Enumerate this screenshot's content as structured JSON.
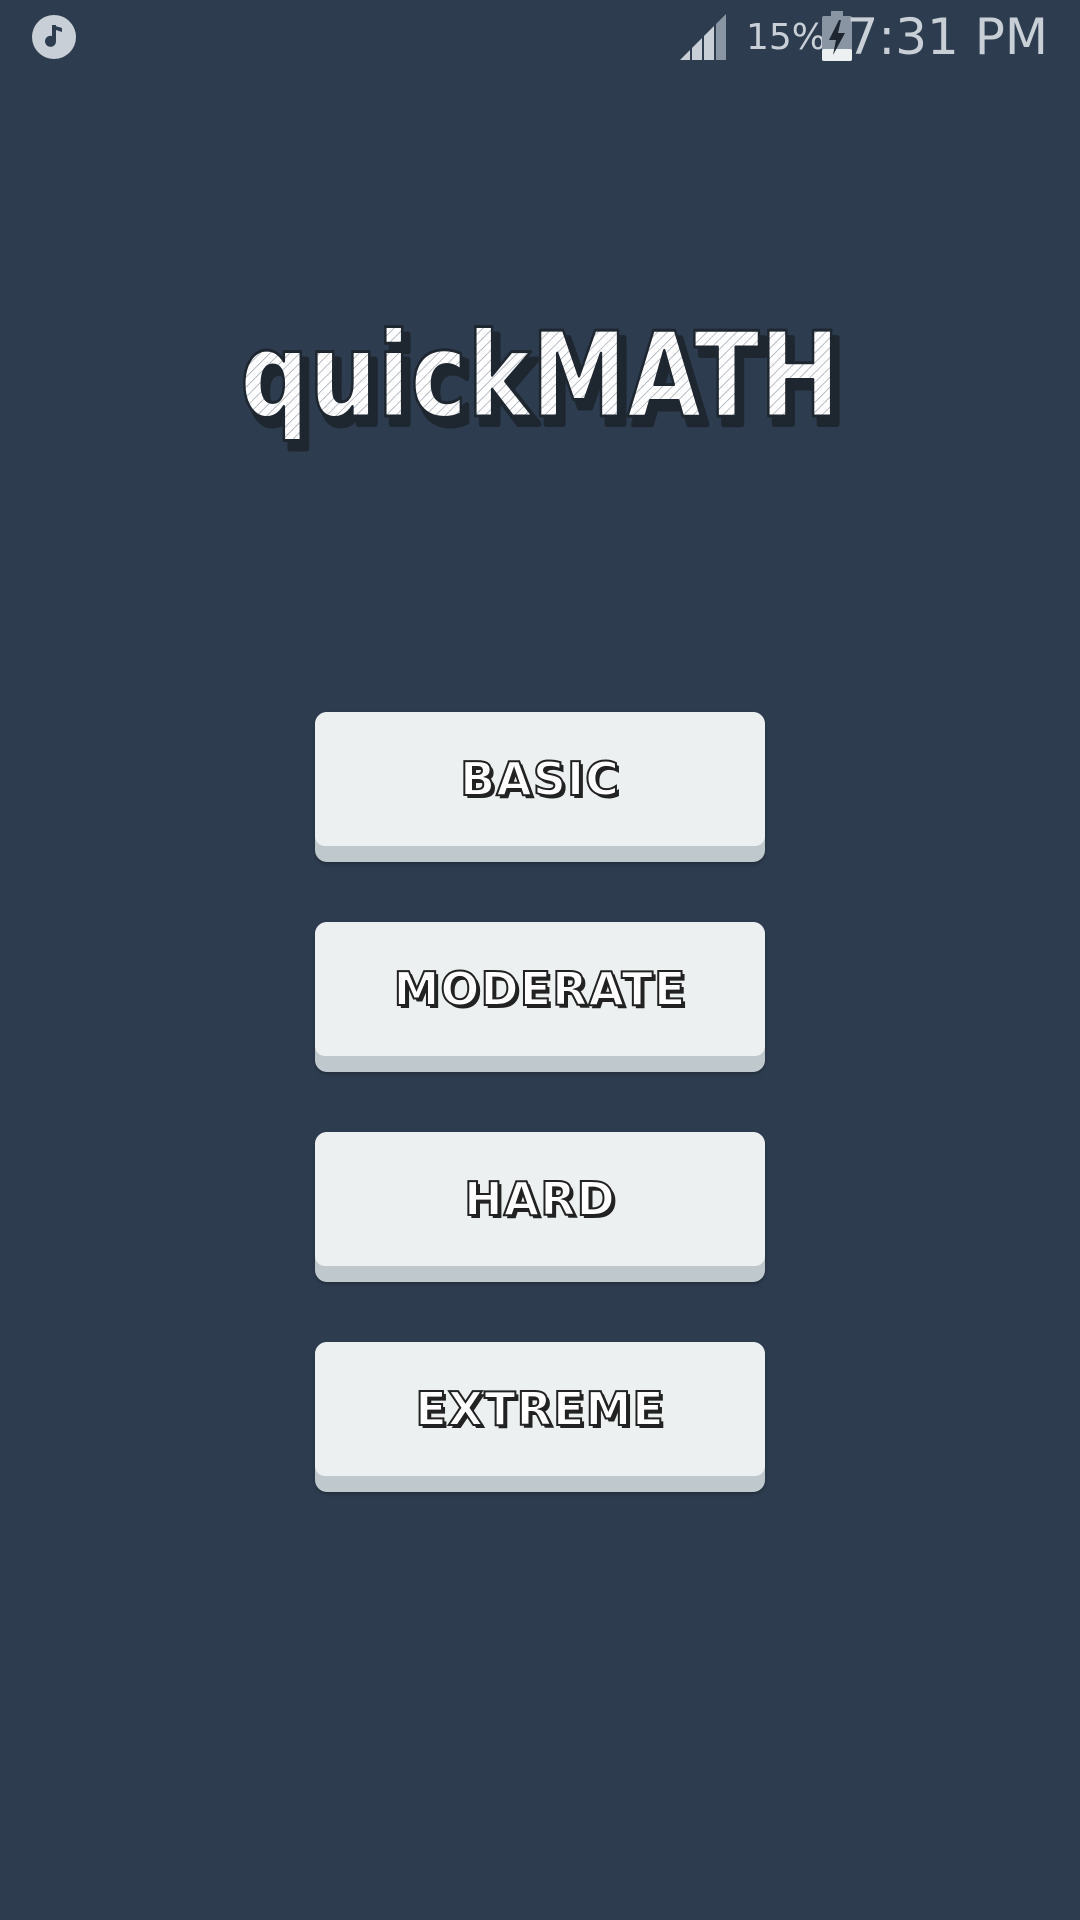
{
  "status_bar": {
    "battery_percent": "15%",
    "time": "7:31 PM",
    "icons": [
      "music-icon",
      "signal-icon",
      "battery-charging-icon"
    ]
  },
  "app": {
    "logo_text": "quickMATH"
  },
  "menu": {
    "buttons": [
      {
        "label": "BASIC"
      },
      {
        "label": "MODERATE"
      },
      {
        "label": "HARD"
      },
      {
        "label": "EXTREME"
      }
    ]
  },
  "colors": {
    "background": "#2d3c4f",
    "button_face": "#ecf0f1",
    "button_shadow": "#bfc8cd",
    "status_text": "#c9cfd6"
  }
}
